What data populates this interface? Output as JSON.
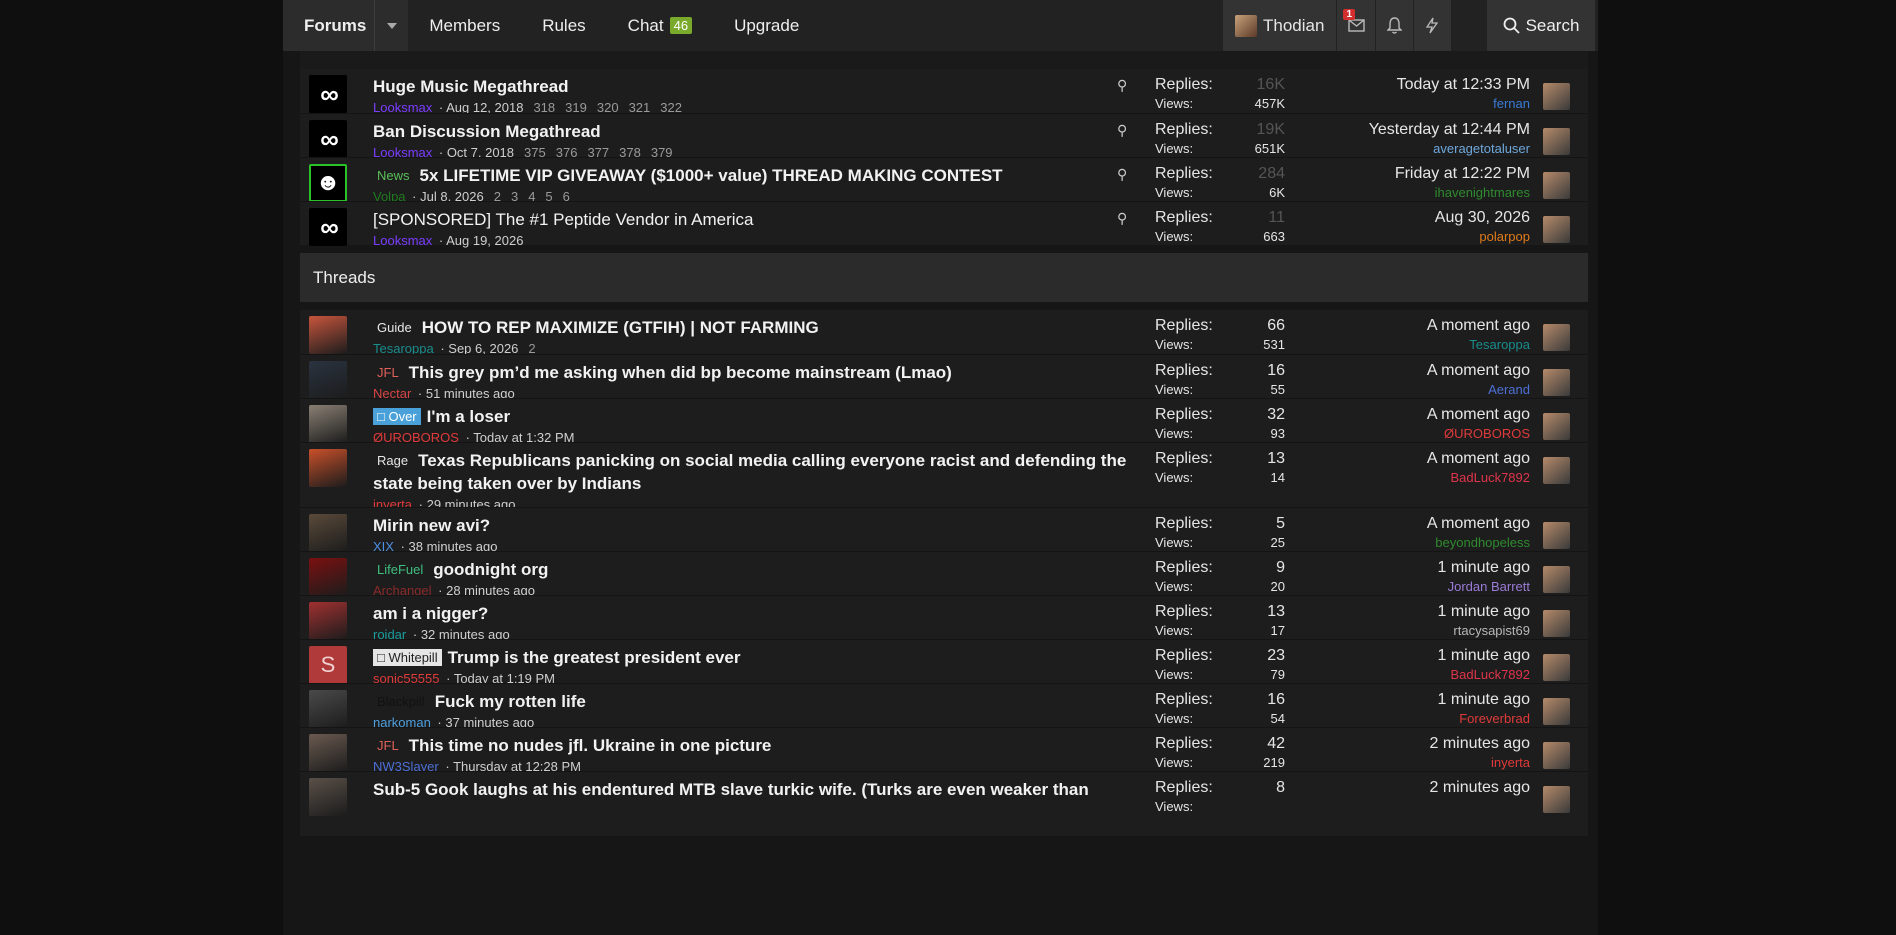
{
  "nav": {
    "tabs": [
      {
        "label": "Forums"
      },
      {
        "label": "Members"
      },
      {
        "label": "Rules"
      },
      {
        "label": "Chat",
        "badge": "46"
      },
      {
        "label": "Upgrade"
      }
    ],
    "user": "Thodian",
    "msg_badge": "1",
    "search": "Search"
  },
  "sticky": [
    {
      "title": "Huge Music Megathread",
      "author": "Looksmax",
      "author_color": "#7b3cff",
      "date": "Aug 12, 2018",
      "pages": [
        "318",
        "319",
        "320",
        "321",
        "322"
      ],
      "replies": "16K",
      "views": "457K",
      "last_when": "Today at 12:33 PM",
      "last_who": "fernan",
      "last_color": "#3a7bd5"
    },
    {
      "title": "Ban Discussion Megathread",
      "author": "Looksmax",
      "author_color": "#7b3cff",
      "date": "Oct 7, 2018",
      "pages": [
        "375",
        "376",
        "377",
        "378",
        "379"
      ],
      "replies": "19K",
      "views": "651K",
      "last_when": "Yesterday at 12:44 PM",
      "last_who": "averagetotaluser",
      "last_color": "#6fa8dc"
    },
    {
      "prefix": "News",
      "prefix_color": "#5bbf5b",
      "title": "5x LIFETIME VIP GIVEAWAY ($1000+ value) THREAD MAKING CONTEST",
      "author": "Volpa",
      "author_color": "#1f7a1f",
      "date": "Jul 8, 2026",
      "pages": [
        "2",
        "3",
        "4",
        "5",
        "6"
      ],
      "replies": "284",
      "views": "6K",
      "last_when": "Friday at 12:22 PM",
      "last_who": "ihavenightmares",
      "last_color": "#2e8b2e"
    },
    {
      "title": "[SPONSORED] The #1 Peptide Vendor in America",
      "author": "Looksmax",
      "author_color": "#7b3cff",
      "date": "Aug 19, 2026",
      "pages": [],
      "replies": "11",
      "views": "663",
      "last_when": "Aug 30, 2026",
      "last_who": "polarpop",
      "last_color": "#e07b1a"
    }
  ],
  "threads_header": "Threads",
  "threads": [
    {
      "prefix": "Guide",
      "prefix_color": "#e6e6e6",
      "title": "HOW TO REP MAXIMIZE (GTFIH) | NOT FARMING",
      "author": "Tesaroppa",
      "author_color": "#1a8c8c",
      "date": "Sep 6, 2026",
      "pages": [
        "2"
      ],
      "replies": "66",
      "views": "531",
      "last_when": "A moment ago",
      "last_who": "Tesaroppa",
      "last_color": "#1a8c8c",
      "av": "#c8553d"
    },
    {
      "prefix": "JFL",
      "prefix_color": "#e0605a",
      "title": "This grey pm’d me asking when did bp become mainstream (Lmao)",
      "author": "Nectar",
      "author_color": "#d64545",
      "date": "51 minutes ago",
      "pages": [],
      "replies": "16",
      "views": "55",
      "last_when": "A moment ago",
      "last_who": "Aerand",
      "last_color": "#4d6fd6",
      "av": "#2a3340"
    },
    {
      "prefix": "□ Over",
      "prefix_color": "#ffffff",
      "prefix_bg": "#4aa0d8",
      "title": "I'm a loser",
      "author": "ØUROBOROS",
      "author_color": "#e03a3a",
      "date": "Today at 1:32 PM",
      "pages": [],
      "replies": "32",
      "views": "93",
      "last_when": "A moment ago",
      "last_who": "ØUROBOROS",
      "last_color": "#e03a3a",
      "av": "#8a8074"
    },
    {
      "prefix": "Rage",
      "prefix_color": "#e6e6e6",
      "title": "Texas Republicans panicking on social media calling everyone racist and defending the state being taken over by Indians",
      "author": "inyerta",
      "author_color": "#e03a3a",
      "date": "29 minutes ago",
      "pages": [],
      "replies": "13",
      "views": "14",
      "last_when": "A moment ago",
      "last_who": "BadLuck7892",
      "last_color": "#e0344a",
      "av": "#c9502a"
    },
    {
      "title": "Mirin new avi?",
      "author": "XIX",
      "author_color": "#4d8fe0",
      "date": "38 minutes ago",
      "pages": [],
      "replies": "5",
      "views": "25",
      "last_when": "A moment ago",
      "last_who": "beyondhopeless",
      "last_color": "#2e8b2e",
      "av": "#5a4a3a"
    },
    {
      "prefix": "LifeFuel",
      "prefix_color": "#3fbf7f",
      "title": "goodnight org",
      "author": "Archangel",
      "author_color": "#8a2a2a",
      "date": "28 minutes ago",
      "pages": [],
      "replies": "9",
      "views": "20",
      "last_when": "1 minute ago",
      "last_who": "Jordan Barrett",
      "last_color": "#9b7bd8",
      "av": "#7a1010"
    },
    {
      "title": "am i a nigger?",
      "author": "roidar",
      "author_color": "#1a9c9c",
      "date": "32 minutes ago",
      "pages": [],
      "replies": "13",
      "views": "17",
      "last_when": "1 minute ago",
      "last_who": "rtacysapist69",
      "last_color": "#b8b8b8",
      "av": "#a03030"
    },
    {
      "prefix": "□ Whitepill",
      "prefix_color": "#222222",
      "prefix_bg": "#e6e6e6",
      "title": "Trump is the greatest president ever",
      "author": "sonic55555",
      "author_color": "#e03a3a",
      "date": "Today at 1:19 PM",
      "pages": [],
      "replies": "23",
      "views": "79",
      "last_when": "1 minute ago",
      "last_who": "BadLuck7892",
      "last_color": "#e0344a",
      "av": "#b03a3a",
      "letter": "S"
    },
    {
      "prefix": "Blackpill",
      "prefix_color": "#111111",
      "title": "Fuck my rotten life",
      "author": "narkoman",
      "author_color": "#4d9fe0",
      "date": "37 minutes ago",
      "pages": [],
      "replies": "16",
      "views": "54",
      "last_when": "1 minute ago",
      "last_who": "Foreverbrad",
      "last_color": "#e03a3a",
      "av": "#4a4a4a"
    },
    {
      "prefix": "JFL",
      "prefix_color": "#e0605a",
      "title": "This time no nudes jfl. Ukraine in one picture",
      "author": "NW3Slayer",
      "author_color": "#4d6fd6",
      "date": "Thursday at 12:28 PM",
      "pages": [],
      "replies": "42",
      "views": "219",
      "last_when": "2 minutes ago",
      "last_who": "inyerta",
      "last_color": "#e03a3a",
      "av": "#6a5a50"
    },
    {
      "title": "Sub-5 Gook laughs at his endentured MTB slave turkic wife. (Turks are even weaker than",
      "author": "",
      "author_color": "#e6e6e6",
      "date": "",
      "pages": [],
      "replies": "8",
      "views": "",
      "last_when": "2 minutes ago",
      "last_who": "",
      "last_color": "#e6e6e6",
      "av": "#5a5048"
    }
  ]
}
